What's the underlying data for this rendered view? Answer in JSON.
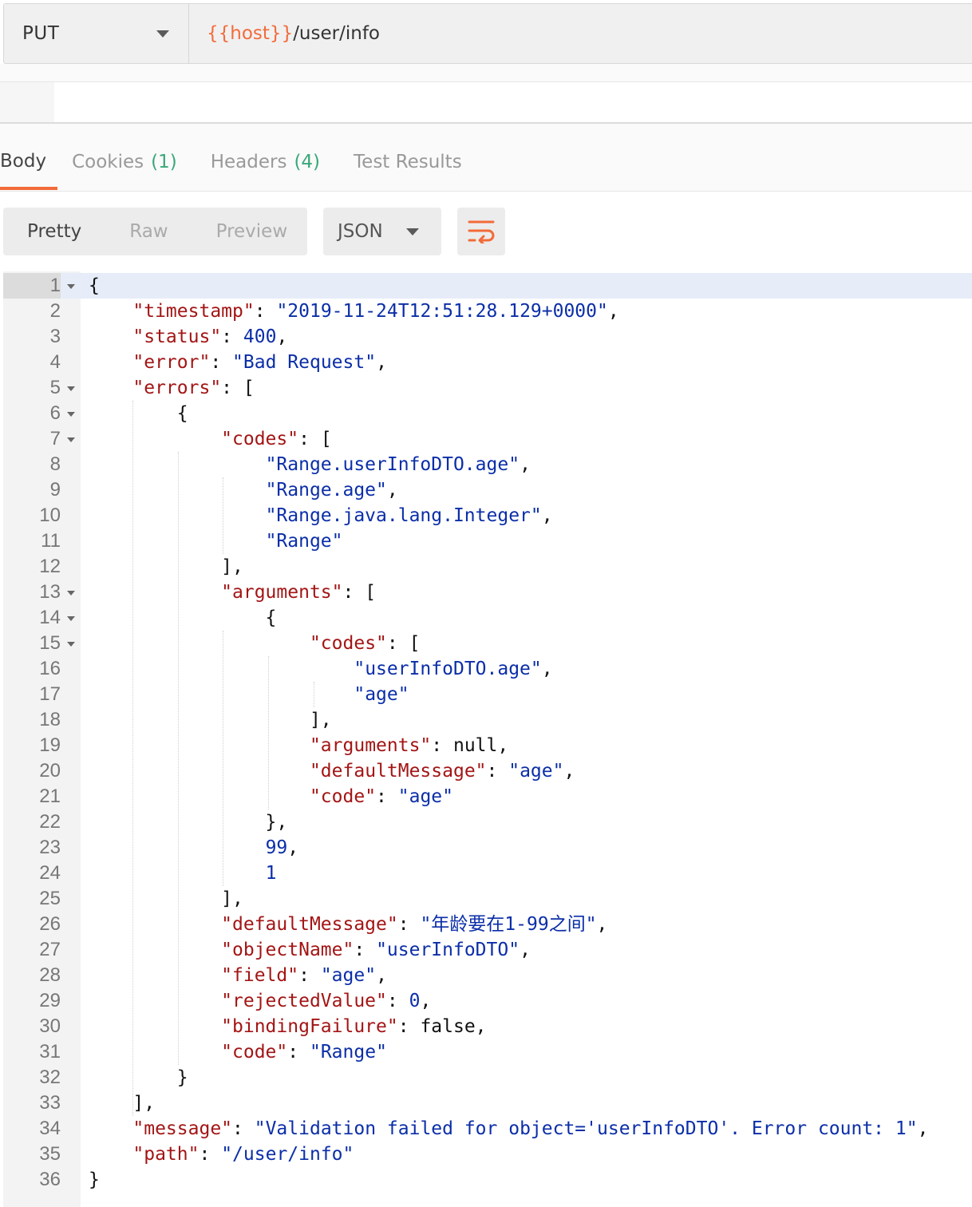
{
  "request": {
    "method": "PUT",
    "url_variable": "{{host}}",
    "url_path": "/user/info"
  },
  "response_tabs": [
    {
      "label": "Body",
      "count": ""
    },
    {
      "label": "Cookies",
      "count": "(1)"
    },
    {
      "label": "Headers",
      "count": "(4)"
    },
    {
      "label": "Test Results",
      "count": ""
    }
  ],
  "view_modes": [
    "Pretty",
    "Raw",
    "Preview"
  ],
  "format": "JSON",
  "icons": {
    "method_dropdown": "chevron-down-icon",
    "format_dropdown": "chevron-down-icon",
    "wrap": "wrap-lines-icon",
    "fold": "fold-caret-icon"
  },
  "colors": {
    "accent": "#f26b3a",
    "count": "#3aa87a",
    "json_key": "#a31515",
    "json_value": "#0b2ea8"
  },
  "code_lines": [
    "{",
    "    \"timestamp\": \"2019-11-24T12:51:28.129+0000\",",
    "    \"status\": 400,",
    "    \"error\": \"Bad Request\",",
    "    \"errors\": [",
    "        {",
    "            \"codes\": [",
    "                \"Range.userInfoDTO.age\",",
    "                \"Range.age\",",
    "                \"Range.java.lang.Integer\",",
    "                \"Range\"",
    "            ],",
    "            \"arguments\": [",
    "                {",
    "                    \"codes\": [",
    "                        \"userInfoDTO.age\",",
    "                        \"age\"",
    "                    ],",
    "                    \"arguments\": null,",
    "                    \"defaultMessage\": \"age\",",
    "                    \"code\": \"age\"",
    "                },",
    "                99,",
    "                1",
    "            ],",
    "            \"defaultMessage\": \"年龄要在1-99之间\",",
    "            \"objectName\": \"userInfoDTO\",",
    "            \"field\": \"age\",",
    "            \"rejectedValue\": 0,",
    "            \"bindingFailure\": false,",
    "            \"code\": \"Range\"",
    "        }",
    "    ],",
    "    \"message\": \"Validation failed for object='userInfoDTO'. Error count: 1\",",
    "    \"path\": \"/user/info\"",
    "}"
  ],
  "foldable_lines": [
    1,
    5,
    6,
    7,
    13,
    14,
    15
  ]
}
